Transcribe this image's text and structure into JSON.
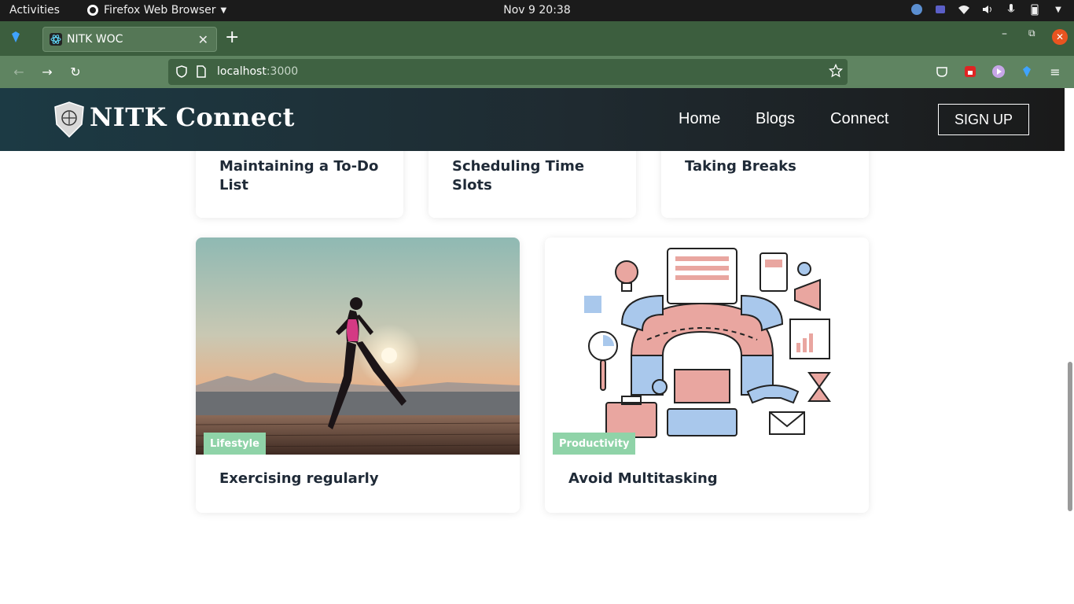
{
  "os_topbar": {
    "activities": "Activities",
    "app_name": "Firefox Web Browser",
    "clock": "Nov 9  20:38"
  },
  "browser": {
    "tab_title": "NITK WOC",
    "url_host": "localhost",
    "url_port": ":3000"
  },
  "site": {
    "brand": "NITK Connect",
    "nav": {
      "home": "Home",
      "blogs": "Blogs",
      "connect": "Connect"
    },
    "signup": "SIGN UP"
  },
  "cards_top": [
    {
      "title_line1": "Maintaining a To-Do",
      "title_line2": "List"
    },
    {
      "title_line1": "Scheduling Time",
      "title_line2": "Slots"
    },
    {
      "title_line1": "Taking Breaks",
      "title_line2": ""
    }
  ],
  "cards_bottom": [
    {
      "category": "Lifestyle",
      "title": "Exercising regularly"
    },
    {
      "category": "Productivity",
      "title": "Avoid Multitasking"
    }
  ],
  "colors": {
    "badge": "#8fd3a8",
    "header_dark": "#1c3a44",
    "firefox_theme": "#3c5e3e"
  }
}
